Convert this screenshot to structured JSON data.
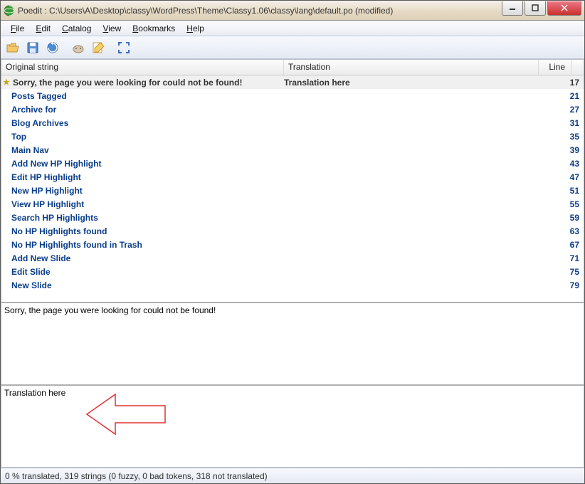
{
  "title": "Poedit : C:\\Users\\A\\Desktop\\classy\\WordPress\\Theme\\Classy1.06\\classy\\lang\\default.po (modified)",
  "menu": {
    "file": "File",
    "edit": "Edit",
    "catalog": "Catalog",
    "view": "View",
    "bookmarks": "Bookmarks",
    "help": "Help"
  },
  "headers": {
    "orig": "Original string",
    "trans": "Translation",
    "line": "Line"
  },
  "rows": [
    {
      "orig": "Sorry, the page you were looking for could not be found!",
      "trans": "Translation here",
      "line": "17",
      "selected": true,
      "star": true
    },
    {
      "orig": "Posts Tagged",
      "trans": "",
      "line": "21"
    },
    {
      "orig": "Archive for",
      "trans": "",
      "line": "27"
    },
    {
      "orig": "Blog Archives",
      "trans": "",
      "line": "31"
    },
    {
      "orig": "Top",
      "trans": "",
      "line": "35"
    },
    {
      "orig": "Main Nav",
      "trans": "",
      "line": "39"
    },
    {
      "orig": "Add New HP Highlight",
      "trans": "",
      "line": "43"
    },
    {
      "orig": "Edit HP Highlight",
      "trans": "",
      "line": "47"
    },
    {
      "orig": "New HP Highlight",
      "trans": "",
      "line": "51"
    },
    {
      "orig": "View HP Highlight",
      "trans": "",
      "line": "55"
    },
    {
      "orig": "Search HP Highlights",
      "trans": "",
      "line": "59"
    },
    {
      "orig": "No HP Highlights found",
      "trans": "",
      "line": "63"
    },
    {
      "orig": "No HP Highlights found in Trash",
      "trans": "",
      "line": "67"
    },
    {
      "orig": "Add New Slide",
      "trans": "",
      "line": "71"
    },
    {
      "orig": "Edit Slide",
      "trans": "",
      "line": "75"
    },
    {
      "orig": "New Slide",
      "trans": "",
      "line": "79"
    }
  ],
  "source_text": "Sorry, the page you were looking for could not be found!",
  "translation_text": "Translation here",
  "status": "0 % translated, 319 strings (0 fuzzy, 0 bad tokens, 318 not translated)"
}
